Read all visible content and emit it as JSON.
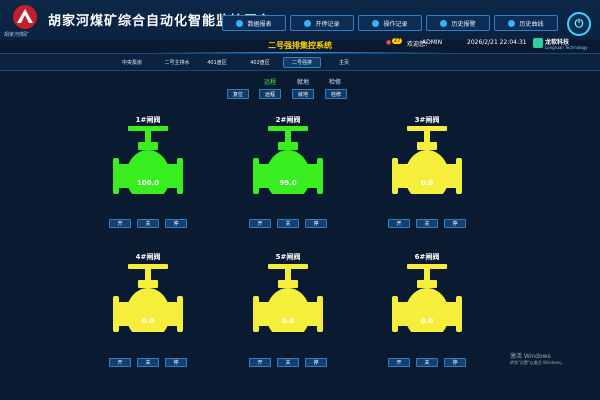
{
  "header": {
    "logo_text": "胡家河煤矿",
    "title": "胡家河煤矿综合自动化智能监控平台",
    "nav": [
      {
        "label": "数据报表",
        "icon": "report-icon"
      },
      {
        "label": "开停记录",
        "icon": "record-icon"
      },
      {
        "label": "操作记录",
        "icon": "operation-icon"
      },
      {
        "label": "历史报警",
        "icon": "alarm-icon"
      },
      {
        "label": "历史曲线",
        "icon": "curve-icon"
      }
    ],
    "system_title": "二号强排集控系统",
    "alarm_count": "27",
    "user_label": "欢迎您：",
    "user_name": "ADMIN",
    "datetime": "2026/2/21   22:04:31",
    "brand_name": "龙软科技",
    "brand_sub": "Longruan Technology"
  },
  "tabs": [
    "中央泵房",
    "二号主排水",
    "401盘区",
    "402盘区",
    "二号强排",
    "主页"
  ],
  "active_tab": "二号强排",
  "modes": {
    "items": [
      "远程",
      "就地",
      "检修"
    ],
    "active": "远程"
  },
  "controls": [
    "复位",
    "远程",
    "就地",
    "检修"
  ],
  "valves": [
    {
      "title": "1#闸阀",
      "value": "100.0",
      "state": "open",
      "buttons": [
        "开",
        "关",
        "停"
      ]
    },
    {
      "title": "2#闸阀",
      "value": "99.0",
      "state": "open",
      "buttons": [
        "开",
        "关",
        "停"
      ]
    },
    {
      "title": "3#闸阀",
      "value": "0.0",
      "state": "closed",
      "buttons": [
        "开",
        "关",
        "停"
      ]
    },
    {
      "title": "4#闸阀",
      "value": "0.0",
      "state": "closed",
      "buttons": [
        "开",
        "关",
        "停"
      ]
    },
    {
      "title": "5#闸阀",
      "value": "0.0",
      "state": "closed",
      "buttons": [
        "开",
        "关",
        "停"
      ]
    },
    {
      "title": "6#闸阀",
      "value": "0.0",
      "state": "closed",
      "buttons": [
        "开",
        "关",
        "停"
      ]
    }
  ],
  "colors": {
    "open": "#39ee1f",
    "closed": "#f5ee3a",
    "title_yellow": "#ffd400",
    "background": "#0a1a30"
  },
  "watermark": {
    "line1": "激活 Windows",
    "line2": "转到\"设置\"以激活 Windows。"
  }
}
